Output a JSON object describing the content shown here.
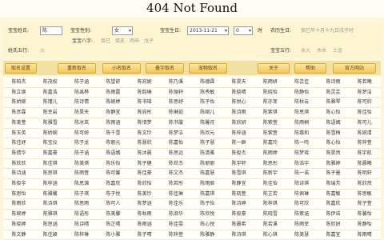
{
  "page": {
    "title": "404 Not Found"
  },
  "form": {
    "baby_name_label": "宝宝姓氏:",
    "baby_name_value": "陈",
    "gender_label": "宝宝性别:",
    "gender_value": "女",
    "birthday_label": "宝宝生日:",
    "birthday_value": "2013-11-21",
    "hour_value": "0",
    "hour_unit": "时",
    "lunar_label": "农历生日:",
    "lunar_hint": "癸巳年十月十九日戌子时",
    "bazi_label": "宝宝八字:",
    "bazi_values": [
      "癸巳",
      "癸亥",
      "丙申",
      "戊子"
    ],
    "wuxing_label_left": "姓氏五行:",
    "wuxing_left_value": "火",
    "wuxing_label_right": "宝宝五行:",
    "wuxing_right_values": [
      "水火",
      "木水",
      "土金"
    ]
  },
  "toolbar": {
    "buttons": [
      "取名设置",
      "重新取名",
      "小名取名",
      "叠字取名",
      "宠物取名"
    ],
    "right_buttons": [
      "关于",
      "帮助",
      "官方网站"
    ]
  },
  "names": [
    [
      "陈柏杰",
      "陈茂权",
      "陈子涵",
      "陈望舒",
      "陈宛妮",
      "陈乃溪",
      "陈德霖",
      "陈昊天",
      "陈雨妍",
      "陈芸佳",
      "陈诗雨",
      "陈若曦"
    ],
    [
      "陈立焕",
      "陈嘉浩",
      "陈禹桦",
      "陈雨露",
      "陈韵琳",
      "陈俪轩",
      "陈秀敏",
      "陈晓晴",
      "陈晓怡",
      "陈静怡",
      "陈灵芸",
      "陈梦洁"
    ],
    [
      "陈娇婉",
      "陈瑾儿",
      "陈诗情",
      "陈婉婷",
      "陈书瑶",
      "陈思妤",
      "陈子怡",
      "陈悦心",
      "陈亦菲",
      "陈秋云",
      "陈雅琴",
      "陈可欣"
    ],
    [
      "陈彦霖",
      "陈幸岩",
      "陈昊天",
      "陈静宜",
      "陈宛彤",
      "陈琳茹",
      "陈婉儿",
      "陈诗雨",
      "陈紫琪",
      "陈思琪",
      "陈心怡",
      "陈佳怡"
    ],
    [
      "陈美萱",
      "陈雅雪",
      "陈冰岚",
      "陈雨涵",
      "陈惜梦",
      "陈书璇",
      "陈馨月",
      "陈欣妍",
      "陈紫萱",
      "陈雨桐",
      "陈语嫣",
      "陈可儿"
    ],
    [
      "陈玉英",
      "陈娇婉",
      "陈可妍",
      "陈千雪",
      "陈文玲",
      "陈梦洁",
      "陈欣元",
      "陈梓涵",
      "陈紫萱",
      "陈惠和",
      "陈雪梅",
      "陈婉清"
    ],
    [
      "陈佳妤",
      "陈宝仪",
      "陈子龙",
      "陈丽元",
      "陈慧欣",
      "陈嘉怡",
      "陈子慧",
      "陈一群",
      "陈嘉玲",
      "陈一鸣",
      "陈心怡",
      "陈梓萱"
    ],
    [
      "陈倩华",
      "陈嘉豪",
      "陈子涵",
      "陈语嫣",
      "陈沐晨",
      "陈思远",
      "陈清雅",
      "陈俊杰",
      "陈雨婷",
      "陈梦瑶",
      "陈昊然",
      "陈宇航"
    ],
    [
      "陈欣欣",
      "陈佳琪",
      "陈美琪",
      "陈乐怡",
      "陈子健",
      "陈世杰",
      "陈丽丽",
      "陈宇轩",
      "陈思彤",
      "陈浩宇",
      "陈雅婷",
      "陈晨曦"
    ],
    [
      "陈诗涵",
      "陈思琪",
      "陈雨萱",
      "陈可馨",
      "陈佳豪",
      "陈文杰",
      "陈嘉慧",
      "陈雪琪",
      "陈新宇",
      "陈一诺",
      "陈子墨",
      "陈明轩"
    ],
    [
      "陈俊宇",
      "陈梓涵",
      "陈思源",
      "陈嘉欣",
      "陈欣怡",
      "陈若彤",
      "陈雨辰",
      "陈静宜",
      "陈佳怡",
      "陈诗琪",
      "陈瑞芳",
      "陈欣然"
    ],
    [
      "陈思怡",
      "陈雅馨",
      "陈子琪",
      "陈子悦",
      "陈美玲",
      "陈佳琳",
      "陈嘉琪",
      "陈晓萱",
      "陈芷若",
      "陈佩琳",
      "陈嘉敏",
      "陈思敏"
    ],
    [
      "陈雨欣",
      "陈诗琪",
      "陈思雨",
      "陈可人",
      "陈梦涵",
      "陈佳乐",
      "陈子怡",
      "陈诗婷",
      "陈梓琪",
      "陈可欣",
      "陈嘉欣",
      "陈子萱"
    ],
    [
      "陈婉婷",
      "陈雅琪",
      "陈语彤",
      "陈美馨",
      "陈秋雨",
      "陈淑华",
      "陈欣悦",
      "陈俊豪",
      "陈晓雪",
      "陈紫涵",
      "陈伊诺",
      "陈馨怡"
    ],
    [
      "陈晓婷",
      "陈思涵",
      "陈诗晴",
      "陈芷晴",
      "陈雨涵",
      "陈佳雯",
      "陈心悦",
      "陈晨希",
      "陈若溪",
      "陈雨菲",
      "陈欣妍",
      "陈静怡"
    ],
    [
      "陈文静",
      "陈佳颖",
      "陈梓琳",
      "陈小雅",
      "陈子晴",
      "陈梓萱",
      "陈雅静",
      "陈诗琪",
      "陈心琪",
      "陈美慧",
      "陈嘉宜",
      "陈雨晴"
    ]
  ]
}
